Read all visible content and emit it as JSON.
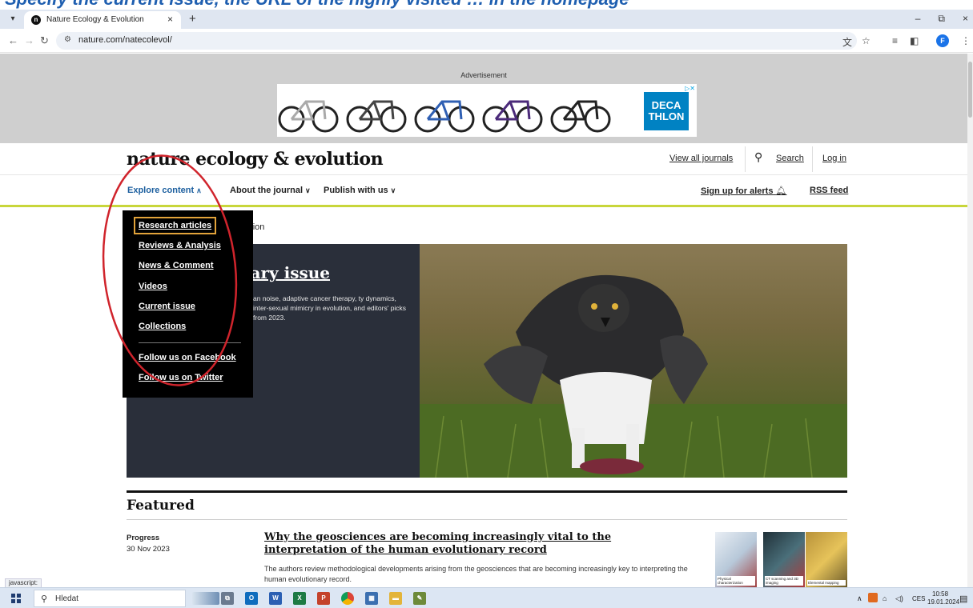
{
  "caption": "Specify the current issue, the URL of the highly visited … in the homepage",
  "browser": {
    "tab_title": "Nature Ecology & Evolution",
    "tab_close": "×",
    "new_tab": "+",
    "url": "nature.com/natecolevol/",
    "window_controls": {
      "minimize": "–",
      "restore": "⧉",
      "close": "×"
    },
    "profile_initial": "F"
  },
  "ad": {
    "label": "Advertisement",
    "brand": "DECA THLON"
  },
  "header": {
    "journal_title": "nature ecology & evolution",
    "view_all_journals": "View all journals",
    "search": "Search",
    "log_in": "Log in"
  },
  "nav": {
    "explore": "Explore content",
    "about": "About the journal",
    "publish": "Publish with us",
    "signup": "Sign up for alerts",
    "rss": "RSS feed"
  },
  "explore_menu": {
    "items": [
      "Research articles",
      "Reviews & Analysis",
      "News & Comment",
      "Videos",
      "Current issue",
      "Collections"
    ],
    "social": [
      "Follow us on Facebook",
      "Follow us on Twitter"
    ]
  },
  "breadcrumb_partial": "olution",
  "hero": {
    "title_partial": "uary issue",
    "desc_partial": "an noise, adaptive cancer therapy, ty dynamics, inter-sexual mimicry in evolution, and editors' picks from 2023."
  },
  "featured": {
    "heading": "Featured",
    "article": {
      "type": "Progress",
      "date": "30 Nov 2023",
      "title": "Why the geosciences are becoming increasingly vital to the interpretation of the human evolutionary record",
      "summary": "The authors review methodological developments arising from the geosciences that are becoming increasingly key to interpreting the human evolutionary record."
    },
    "thumbnails": [
      "Physical characterization",
      "CT scanning and 3D imaging",
      "Elemental mapping"
    ]
  },
  "status_tip": "javascript:",
  "taskbar": {
    "search_placeholder": "Hledat",
    "lang": "CES",
    "time": "10:58",
    "date": "19.01.2024"
  }
}
